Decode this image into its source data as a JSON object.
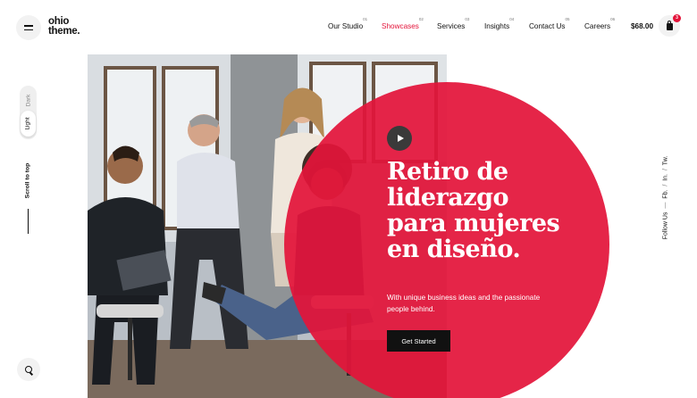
{
  "header": {
    "logo_line1": "ohio",
    "logo_line2": "theme.",
    "nav": [
      {
        "label": "Our Studio",
        "num": "01"
      },
      {
        "label": "Showcases",
        "num": "02"
      },
      {
        "label": "Services",
        "num": "03"
      },
      {
        "label": "Insights",
        "num": "04"
      },
      {
        "label": "Contact Us",
        "num": "05"
      },
      {
        "label": "Careers",
        "num": "06"
      }
    ],
    "cart_total": "$68.00",
    "cart_count": "3",
    "menu_icon": "hamburger-icon",
    "cart_icon": "shopping-bag-icon"
  },
  "sidebar": {
    "mode_dark": "Dark",
    "mode_light": "Light",
    "scroll_to_top": "Scroll to top",
    "search_icon": "search-icon"
  },
  "social": {
    "follow": "Follow Us",
    "dash": "—",
    "fb": "Fb.",
    "in": "In.",
    "tw": "Tw.",
    "sep": "/"
  },
  "hero": {
    "headline": [
      "Retiro de",
      "liderazgo",
      "para mujeres",
      "en diseño."
    ],
    "subtext": "With unique business ideas and the passionate people behind.",
    "cta": "Get Started",
    "play_icon": "play-icon"
  },
  "colors": {
    "accent": "#e3143a",
    "text": "#111111",
    "button_bg": "#111111"
  }
}
